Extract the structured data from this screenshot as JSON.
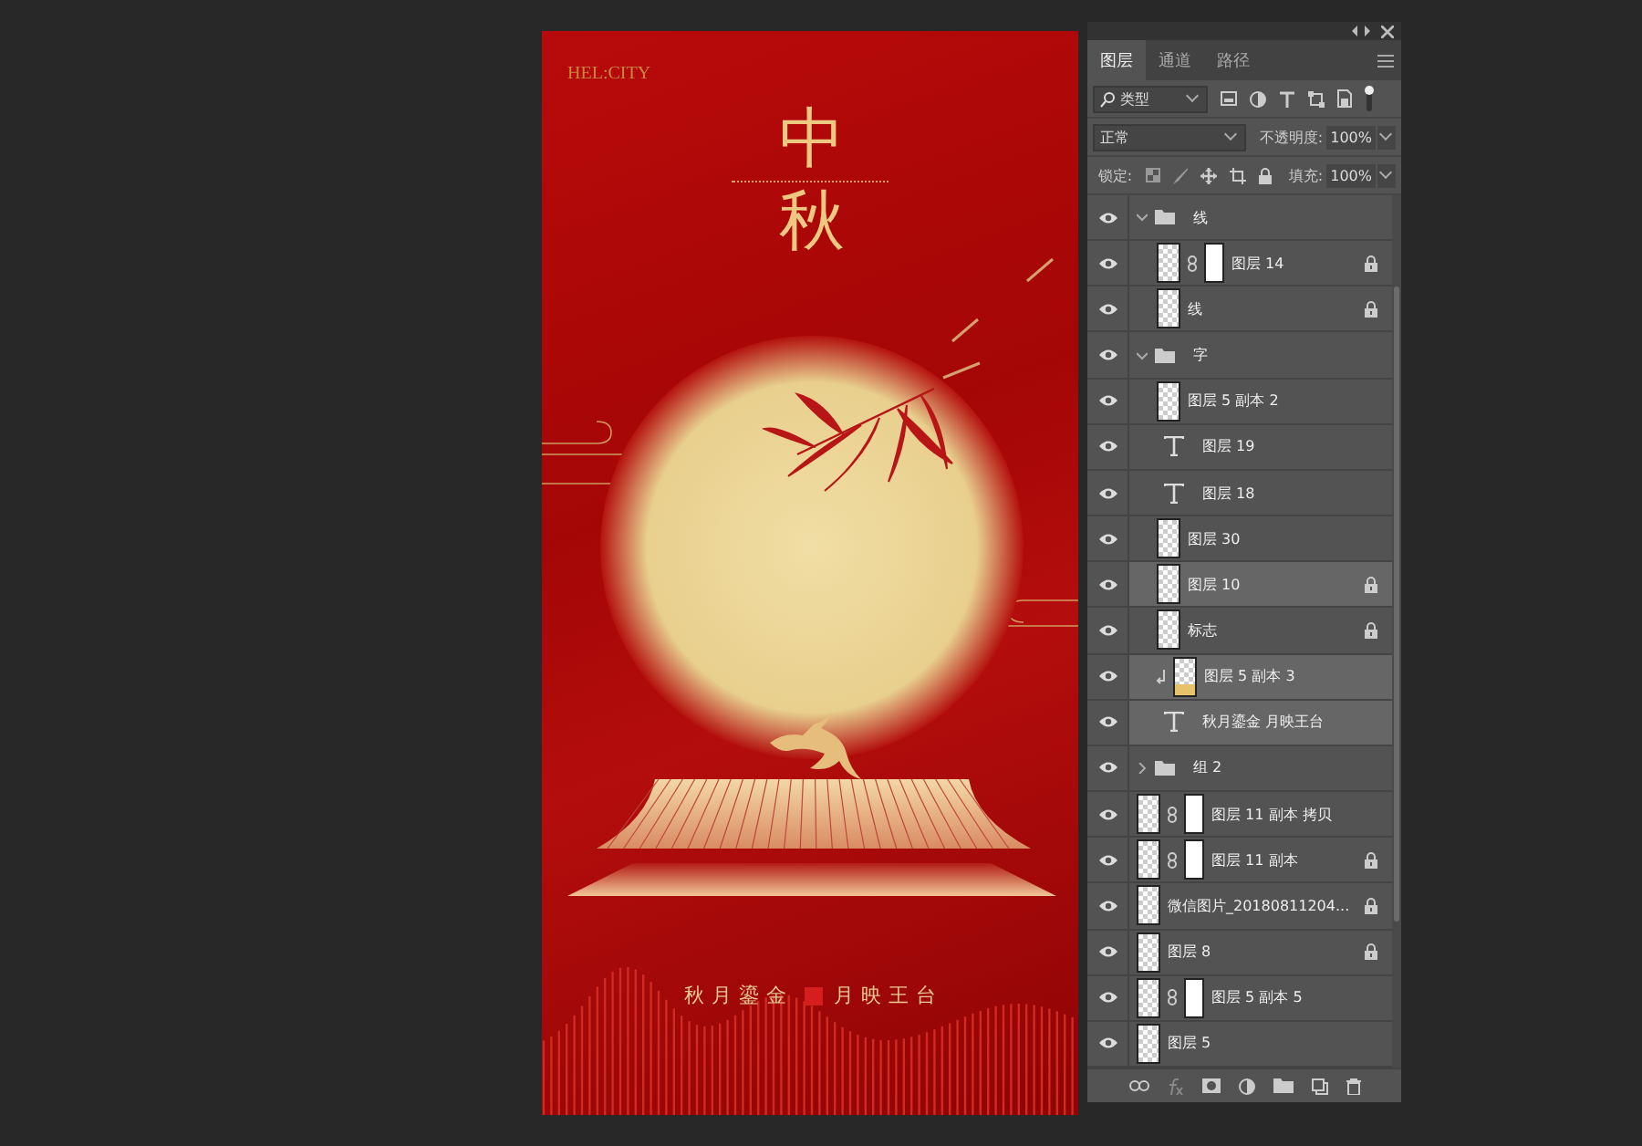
{
  "canvas": {
    "logo": "HEL:CITY",
    "title_chars": [
      "中",
      "秋"
    ],
    "tagline_left": "秋月鎏金",
    "tagline_right": "月映王台"
  },
  "panel": {
    "tabs": [
      {
        "label": "图层",
        "selected": true
      },
      {
        "label": "通道",
        "selected": false
      },
      {
        "label": "路径",
        "selected": false
      }
    ],
    "filter": "类型",
    "blend_mode": "正常",
    "opacity_label": "不透明度:",
    "opacity": "100%",
    "lock_label": "锁定:",
    "fill_label": "填充:",
    "fill": "100%",
    "layers": [
      {
        "kind": "group",
        "name": "线",
        "expanded": true,
        "locked": false,
        "selected": false,
        "children": [
          {
            "kind": "masked",
            "name": "图层 14",
            "locked": true,
            "selected": false
          },
          {
            "kind": "raster",
            "name": "线",
            "locked": true,
            "selected": false
          }
        ]
      },
      {
        "kind": "group",
        "name": "字",
        "expanded": true,
        "locked": false,
        "selected": false,
        "children": [
          {
            "kind": "raster",
            "name": "图层 5 副本 2",
            "locked": false,
            "selected": false
          },
          {
            "kind": "text",
            "name": "图层 19",
            "locked": false,
            "selected": false
          },
          {
            "kind": "text",
            "name": "图层 18",
            "locked": false,
            "selected": false
          },
          {
            "kind": "raster",
            "name": "图层 30",
            "locked": false,
            "selected": false
          },
          {
            "kind": "raster",
            "name": "图层 10",
            "locked": true,
            "selected": true
          },
          {
            "kind": "raster",
            "name": "标志",
            "locked": true,
            "selected": false
          },
          {
            "kind": "clipped",
            "name": "图层 5 副本 3",
            "locked": false,
            "selected": true
          },
          {
            "kind": "text",
            "name": "秋月鎏金 月映王台",
            "locked": false,
            "selected": true
          }
        ]
      },
      {
        "kind": "group",
        "name": "组 2",
        "expanded": false,
        "locked": false,
        "selected": false
      },
      {
        "kind": "masked",
        "name": "图层 11 副本 拷贝",
        "locked": false,
        "selected": false
      },
      {
        "kind": "masked",
        "name": "图层 11 副本",
        "locked": true,
        "selected": false
      },
      {
        "kind": "raster",
        "name": "微信图片_20180811204...",
        "locked": true,
        "selected": false
      },
      {
        "kind": "raster",
        "name": "图层 8",
        "locked": true,
        "selected": false
      },
      {
        "kind": "masked",
        "name": "图层 5 副本 5",
        "locked": false,
        "selected": false
      },
      {
        "kind": "raster",
        "name": "图层 5",
        "locked": false,
        "selected": false
      }
    ]
  }
}
